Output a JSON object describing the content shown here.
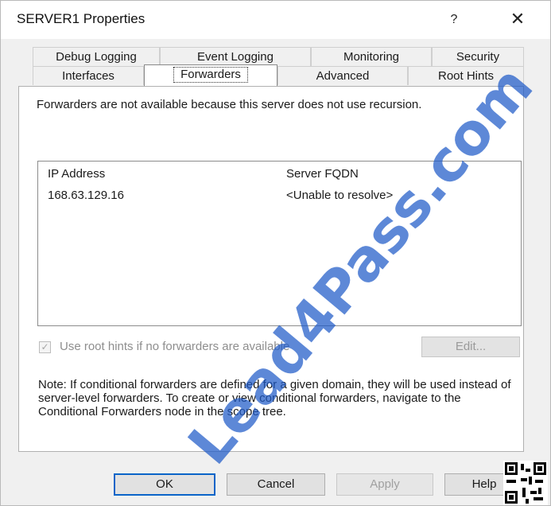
{
  "window": {
    "title": "SERVER1 Properties",
    "help_glyph": "?",
    "close_glyph": "✕"
  },
  "tabs": {
    "row1": [
      "Debug Logging",
      "Event Logging",
      "Monitoring",
      "Security"
    ],
    "row2": [
      "Interfaces",
      "Forwarders",
      "Advanced",
      "Root Hints"
    ],
    "selected": "Forwarders"
  },
  "panel": {
    "info": "Forwarders are not available because this server does not use recursion.",
    "list": {
      "columns": [
        "IP Address",
        "Server FQDN"
      ],
      "rows": [
        {
          "ip": "168.63.129.16",
          "fqdn": "<Unable to resolve>"
        }
      ]
    },
    "use_root_hints": {
      "label": "Use root hints if no forwarders are available",
      "checked": true,
      "enabled": false
    },
    "edit_label": "Edit...",
    "note": "Note: If conditional forwarders are defined for a given domain, they will be used instead of server-level forwarders.  To create or view conditional forwarders, navigate to the Conditional Forwarders node in the scope tree."
  },
  "buttons": {
    "ok": "OK",
    "cancel": "Cancel",
    "apply": "Apply",
    "help": "Help"
  },
  "watermark": "Lead4Pass.com"
}
